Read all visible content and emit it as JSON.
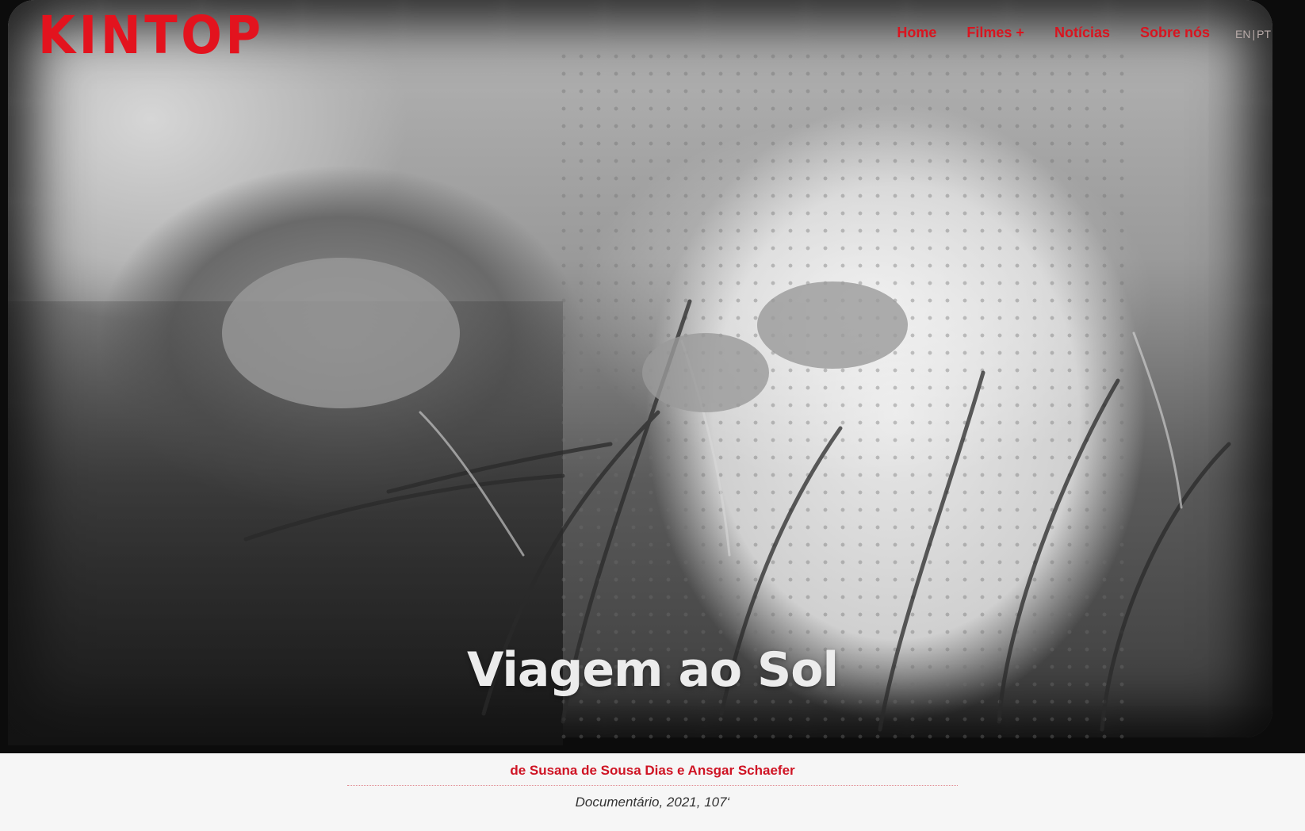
{
  "brand": {
    "logo_text": "KINTOP",
    "accent_color": "#e3131e"
  },
  "nav": {
    "items": [
      {
        "label": "Home"
      },
      {
        "label": "Filmes +"
      },
      {
        "label": "Notícias"
      },
      {
        "label": "Sobre nós"
      }
    ],
    "languages": {
      "en": "EN",
      "pt": "PT"
    }
  },
  "hero": {
    "image_description_icon": "photo-icon",
    "title": "Viagem ao Sol"
  },
  "film": {
    "authors": "de Susana de Sousa Dias e Ansgar Schaefer",
    "meta": "Documentário, 2021, 107‘"
  }
}
